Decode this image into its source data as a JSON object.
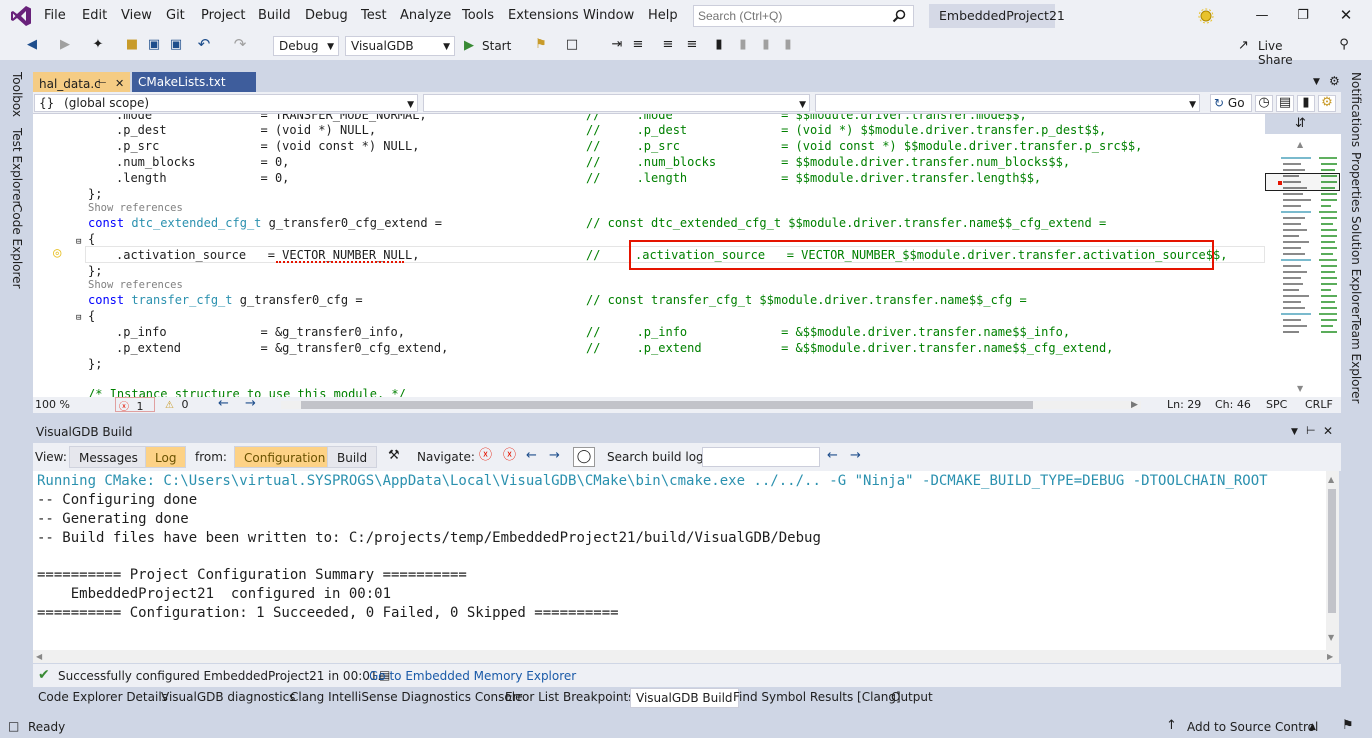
{
  "menu": [
    "File",
    "Edit",
    "View",
    "Git",
    "Project",
    "Build",
    "Debug",
    "Test",
    "Analyze",
    "Tools",
    "Extensions",
    "Window",
    "Help"
  ],
  "search": {
    "placeholder": "Search (Ctrl+Q)"
  },
  "project_title": "EmbeddedProject21",
  "toolbar": {
    "config": "Debug",
    "platform": "VisualGDB",
    "start": "Start",
    "live_share": "Live Share"
  },
  "side_left": [
    "Toolbox",
    "Test Explorer",
    "Code Explorer"
  ],
  "side_right": [
    "Notifications",
    "Properties",
    "Solution Explorer",
    "Team Explorer"
  ],
  "doc_tabs": [
    "hal_data.c",
    "CMakeLists.txt"
  ],
  "navbar": {
    "scope": "(global scope)",
    "scope_icon": "{}",
    "go": "Go"
  },
  "code": {
    "l1": ".mode               = TRANSFER_MODE_NORMAL,",
    "l1c": "//     .mode               = $$module.driver.transfer.mode$$,",
    "l2": ".p_dest             = (void *) NULL,",
    "l2c": "//     .p_dest             = (void *) $$module.driver.transfer.p_dest$$,",
    "l3": ".p_src              = (void const *) NULL,",
    "l3c": "//     .p_src              = (void const *) $$module.driver.transfer.p_src$$,",
    "l4": ".num_blocks         = 0,",
    "l4c": "//     .num_blocks         = $$module.driver.transfer.num_blocks$$,",
    "l5": ".length             = 0,",
    "l5c": "//     .length             = $$module.driver.transfer.length$$,",
    "l6": "};",
    "ref1": "Show references",
    "l7a": "const ",
    "l7t": "dtc_extended_cfg_t",
    "l7b": " g_transfer0_cfg_extend =",
    "l7c": "// const dtc_extended_cfg_t $$module.driver.transfer.name$$_cfg_extend =",
    "l8": "{",
    "l9": ".activation_source   = VECTOR_NUMBER_NULL,",
    "l9c": "//",
    "l9h": ".activation_source   = VECTOR_NUMBER_$$module.driver.transfer.activation_source$$,",
    "l10": "};",
    "ref2": "Show references",
    "l11a": "const ",
    "l11t": "transfer_cfg_t",
    "l11b": " g_transfer0_cfg =",
    "l11c": "// const transfer_cfg_t $$module.driver.transfer.name$$_cfg =",
    "l12": "{",
    "l13": ".p_info             = &g_transfer0_info,",
    "l13c": "//     .p_info             = &$$module.driver.transfer.name$$_info,",
    "l14": ".p_extend           = &g_transfer0_cfg_extend,",
    "l14c": "//     .p_extend           = &$$module.driver.transfer.name$$_cfg_extend,",
    "l15": "};",
    "l16": "/* Instance structure to use this module. */"
  },
  "editor_status": {
    "zoom": "100 %",
    "errors": "1",
    "warnings": "0",
    "line": "Ln: 29",
    "col": "Ch: 46",
    "spc": "SPC",
    "crlf": "CRLF"
  },
  "panel": {
    "title": "VisualGDB Build",
    "view_label": "View:",
    "messages": "Messages",
    "log": "Log",
    "from_label": "from:",
    "configuration": "Configuration",
    "build": "Build",
    "navigate": "Navigate:",
    "search_label": "Search build log:"
  },
  "build_log": [
    "Running CMake: C:\\Users\\virtual.SYSPROGS\\AppData\\Local\\VisualGDB\\CMake\\bin\\cmake.exe ../../.. -G \"Ninja\" -DCMAKE_BUILD_TYPE=DEBUG -DTOOLCHAIN_ROOT",
    "-- Configuring done",
    "-- Generating done",
    "-- Build files have been written to: C:/projects/temp/EmbeddedProject21/build/VisualGDB/Debug",
    "",
    "========== Project Configuration Summary ==========",
    "    EmbeddedProject21  configured in 00:01",
    "========== Configuration: 1 Succeeded, 0 Failed, 0 Skipped =========="
  ],
  "build_status": {
    "message": "Successfully configured EmbeddedProject21 in 00:01.",
    "link": "Go to Embedded Memory Explorer"
  },
  "bottom_tabs": [
    "Code Explorer Details",
    "VisualGDB diagnostics",
    "Clang IntelliSense Diagnostics Console",
    "Error List",
    "Breakpoints",
    "VisualGDB Build",
    "Find Symbol Results [Clang]",
    "Output"
  ],
  "statusbar": {
    "ready": "Ready",
    "source_control": "Add to Source Control"
  },
  "colors": {
    "accent": "#68217a",
    "highlight_box": "#e51400",
    "log_cyan": "#2b91af",
    "tab_active": "#fdd286"
  }
}
